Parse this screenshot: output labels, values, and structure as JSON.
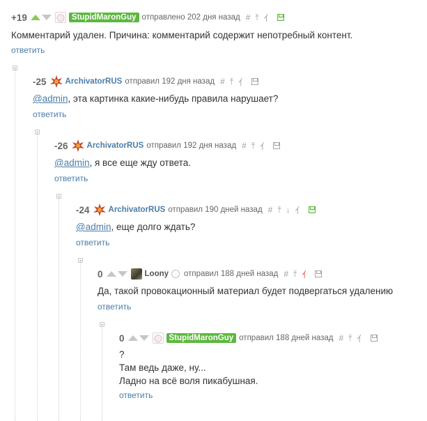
{
  "colors": {
    "link": "#4a7da8",
    "tag_green": "#5cb83e",
    "vote_green": "#8ac858",
    "red_icon": "#d9533b"
  },
  "comments": [
    {
      "rating": "+19",
      "nick": "StupidMaronGuy",
      "meta": "отправлено 202 дня назад",
      "body": "Комментарий удален. Причина: комментарий содержит непотребный контент.",
      "reply": "ответить"
    },
    {
      "rating": "-25",
      "nick": "ArchivatorRUS",
      "meta": "отправил 192 дня назад",
      "mention": "@admin",
      "body": ", эта картинка какие-нибудь правила нарушает?",
      "reply": "ответить"
    },
    {
      "rating": "-26",
      "nick": "ArchivatorRUS",
      "meta": "отправил 192 дня назад",
      "mention": "@admin",
      "body": ", я все еще жду ответа.",
      "reply": "ответить"
    },
    {
      "rating": "-24",
      "nick": "ArchivatorRUS",
      "meta": "отправил 190 дней назад",
      "mention": "@admin",
      "body": ", еще долго ждать?",
      "reply": "ответить"
    },
    {
      "rating": "0",
      "nick": "Loony",
      "meta": "отправил 188 дней назад",
      "body": "Да, такой провокационный материал будет подвергаться удалению",
      "reply": "ответить"
    },
    {
      "rating": "0",
      "nick": "StupidMaronGuy",
      "meta": "отправил 188 дней назад",
      "lines": [
        "?",
        "Там ведь даже, ну...",
        "Ладно на всё воля пикабушная."
      ],
      "reply": "ответить"
    }
  ],
  "icons": {
    "hash": "#",
    "up_arrow": "⤒",
    "down_arrow": "↓",
    "branch": "⺅"
  }
}
